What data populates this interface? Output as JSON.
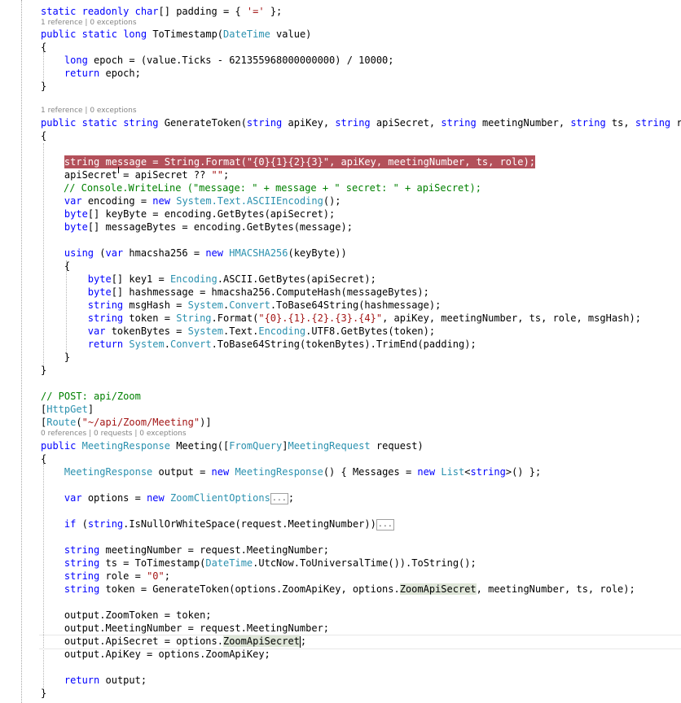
{
  "code": {
    "padding_decl": [
      "static",
      "readonly",
      "char",
      "[] padding = { ",
      "'='",
      " };"
    ],
    "lens_to_timestamp": "1 reference | 0 exceptions",
    "to_timestamp_sig": [
      "public",
      "static",
      "long",
      "ToTimestamp(",
      "DateTime",
      " value)"
    ],
    "brace_open": "{",
    "brace_close": "}",
    "epoch_line": [
      "long",
      " epoch = (value.Ticks - 621355968000000000) / 10000;"
    ],
    "return_epoch": [
      "return",
      " epoch;"
    ],
    "lens_generate_token": "1 reference | 0 exceptions",
    "generate_token_sig": [
      "public",
      "static",
      "string",
      " GenerateToken(",
      "string",
      " apiKey, ",
      "string",
      " apiSecret, ",
      "string",
      " meetingNumber, ",
      "string",
      " ts, ",
      "string",
      " role"
    ],
    "message_line": [
      "string",
      " message = ",
      "String",
      ".Format(",
      "\"{0}{1}{2}{3}\"",
      ", apiKey, meetingNumber, ts, role);"
    ],
    "api_secret_line": [
      "apiSecret = apiSecret ?? ",
      "\"\"",
      ";"
    ],
    "console_comment": "// Console.WriteLine (\"message: \" + message + \" secret: \" + apiSecret);",
    "encoding_line": [
      "var",
      " encoding = ",
      "new",
      " ",
      "System",
      ".Text.",
      "ASCIIEncoding",
      "();"
    ],
    "keybyte_line": [
      "byte",
      "[] keyByte = encoding.",
      "GetBytes",
      "(apiSecret);"
    ],
    "messagebytes_line": [
      "byte",
      "[] messageBytes = encoding.",
      "GetBytes",
      "(message);"
    ],
    "using_line": [
      "using",
      " (",
      "var",
      " hmacsha256 = ",
      "new",
      " ",
      "HMACSHA256",
      "(keyByte))"
    ],
    "key1_line": [
      "byte",
      "[] key1 = ",
      "Encoding",
      ".ASCII.",
      "GetBytes",
      "(apiSecret);"
    ],
    "hashmessage_line": [
      "byte",
      "[] hashmessage = hmacsha256.",
      "ComputeHash",
      "(messageBytes);"
    ],
    "msghash_line": [
      "string",
      " msgHash = ",
      "System",
      ".",
      "Convert",
      ".",
      "ToBase64String",
      "(hashmessage);"
    ],
    "token_line": [
      "string",
      " token = ",
      "String",
      ".Format(",
      "\"{0}.{1}.{2}.{3}.{4}\"",
      ", apiKey, meetingNumber, ts, role, msgHash);"
    ],
    "tokenbytes_line": [
      "var",
      " tokenBytes = ",
      "System",
      ".Text.",
      "Encoding",
      ".UTF8.",
      "GetBytes",
      "(token);"
    ],
    "return_token_line": [
      "return",
      " ",
      "System",
      ".",
      "Convert",
      ".",
      "ToBase64String",
      "(tokenBytes).",
      "TrimEnd",
      "(padding);"
    ],
    "post_comment": "// POST: api/Zoom",
    "httpget_attr": [
      "[",
      "HttpGet",
      "]"
    ],
    "route_attr": [
      "[",
      "Route",
      "(",
      "\"~/api/Zoom/Meeting\"",
      ")]"
    ],
    "lens_meeting": "0 references | 0 requests | 0 exceptions",
    "meeting_sig": [
      "public",
      " ",
      "MeetingResponse",
      " Meeting([",
      "FromQuery",
      "]",
      "MeetingRequest",
      " request)"
    ],
    "output_line": [
      "MeetingResponse",
      " output = ",
      "new",
      " ",
      "MeetingResponse",
      "() { Messages = ",
      "new",
      " ",
      "List",
      "<",
      "string",
      ">() };"
    ],
    "options_line": [
      "var",
      " options = ",
      "new",
      " ",
      "ZoomClientOptions",
      "...",
      ";"
    ],
    "if_line": [
      "if",
      " (",
      "string",
      ".",
      "IsNullOrWhiteSpace",
      "(request.MeetingNumber))",
      "..."
    ],
    "meetingnumber_line": [
      "string",
      " meetingNumber = request.MeetingNumber;"
    ],
    "ts_line": [
      "string",
      " ts = ",
      "ToTimestamp",
      "(",
      "DateTime",
      ".",
      "UtcNow",
      ".",
      "ToUniversalTime",
      "()).",
      "ToString",
      "();"
    ],
    "role_line": [
      "string",
      " role = ",
      "\"0\"",
      ";"
    ],
    "gentoken_call_line": [
      "string",
      " token = ",
      "GenerateToken",
      "(options.ZoomApiKey, options.",
      "ZoomApiSecret",
      ", meetingNumber, ts, role);"
    ],
    "zoomtoken_line": "output.ZoomToken = token;",
    "out_meetingnumber_line": "output.MeetingNumber = request.MeetingNumber;",
    "out_apisecret_line": [
      "output.ApiSecret = options.",
      "ZoomApiSecret",
      ";"
    ],
    "out_apikey_line": "output.ApiKey = options.ZoomApiKey;",
    "return_output_line": [
      "return",
      " output;"
    ]
  },
  "colors": {
    "keyword": "#0000ff",
    "type": "#2b91af",
    "string": "#a31515",
    "comment": "#008000",
    "breakpoint_highlight": "#b3505a",
    "reference_highlight": "#dfe6d9"
  }
}
